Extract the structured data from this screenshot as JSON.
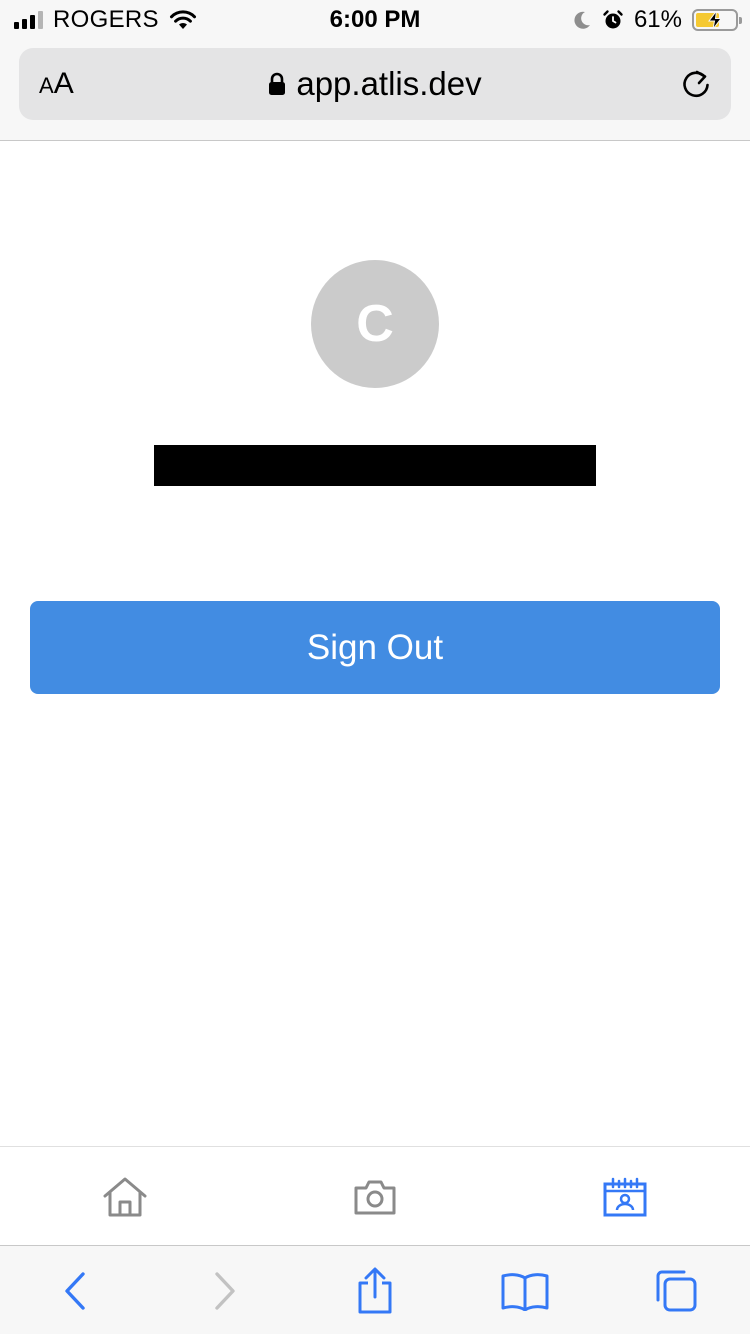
{
  "status_bar": {
    "carrier": "ROGERS",
    "time": "6:00 PM",
    "battery_percent": "61%",
    "battery_level": 0.61,
    "icons": [
      "signal-icon",
      "wifi-icon",
      "moon-icon",
      "alarm-icon",
      "battery-icon"
    ]
  },
  "browser": {
    "text_size_label_small": "A",
    "text_size_label_large": "A",
    "url": "app.atlis.dev",
    "icons": [
      "lock-icon",
      "reload-icon"
    ],
    "toolbar_icons": [
      "back-icon",
      "forward-icon",
      "share-icon",
      "bookmarks-icon",
      "tabs-icon"
    ]
  },
  "profile": {
    "avatar_initial": "C",
    "sign_out_label": "Sign Out"
  },
  "app_tabs": [
    {
      "icon": "home-icon",
      "active": false
    },
    {
      "icon": "camera-icon",
      "active": false
    },
    {
      "icon": "calendar-person-icon",
      "active": true
    }
  ],
  "colors": {
    "accent": "#428ce2",
    "ios_blue": "#3478f6",
    "avatar_bg": "#cbcbcb",
    "inactive_icon": "#8a8a8a",
    "battery_charge": "#f5c932"
  }
}
